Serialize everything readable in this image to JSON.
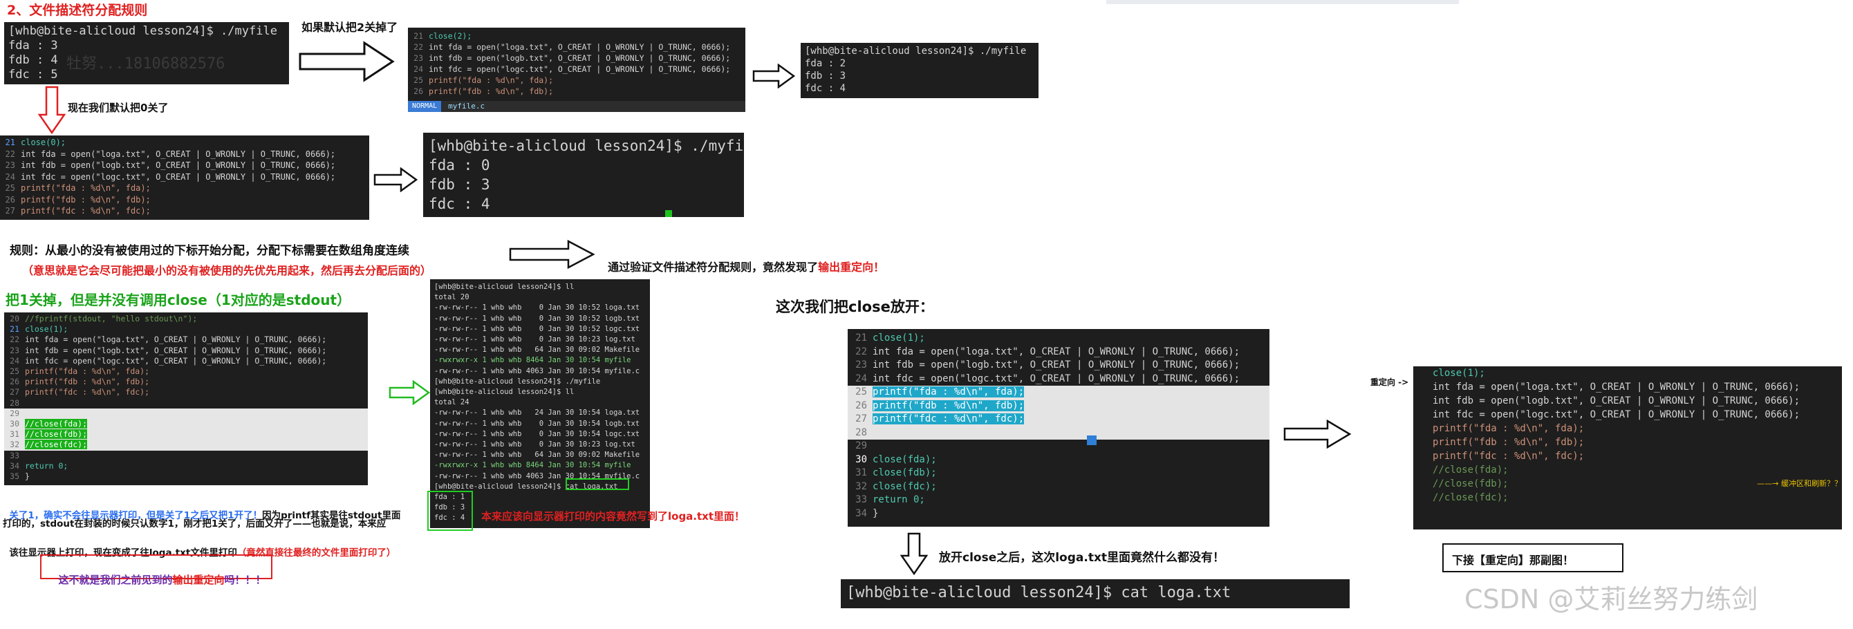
{
  "header": {
    "title": "2、文件描述符分配规则"
  },
  "panel1": {
    "prompt": "[whb@bite-alicloud lesson24]$ ./myfile",
    "lines": [
      "fda : 3",
      "fdb : 4",
      "fdc : 5"
    ],
    "watermark": "牡努...18106882576"
  },
  "note_default_close2": "如果默认把2关掉了",
  "note_close0": "现在我们默认把0关了",
  "panel2": {
    "line_numbers": [
      "21",
      "22",
      "23",
      "24",
      "25",
      "26"
    ],
    "lines": [
      "close(2);",
      "int fda = open(\"loga.txt\", O_CREAT | O_WRONLY | O_TRUNC, 0666);",
      "int fdb = open(\"logb.txt\", O_CREAT | O_WRONLY | O_TRUNC, 0666);",
      "int fdc = open(\"logc.txt\", O_CREAT | O_WRONLY | O_TRUNC, 0666);",
      "printf(\"fda : %d\\n\", fda);",
      "printf(\"fdb : %d\\n\", fdb);"
    ],
    "mode": "NORMAL",
    "file": "myfile.c"
  },
  "panel3": {
    "prompt": "[whb@bite-alicloud lesson24]$ ./myfile",
    "lines": [
      "fda : 2",
      "fdb : 3",
      "fdc : 4"
    ]
  },
  "panel4": {
    "line_numbers": [
      "21",
      "22",
      "23",
      "24",
      "25",
      "26",
      "27"
    ],
    "lines": [
      "close(0);",
      "int fda = open(\"loga.txt\", O_CREAT | O_WRONLY | O_TRUNC, 0666);",
      "int fdb = open(\"logb.txt\", O_CREAT | O_WRONLY | O_TRUNC, 0666);",
      "int fdc = open(\"logc.txt\", O_CREAT | O_WRONLY | O_TRUNC, 0666);",
      "printf(\"fda : %d\\n\", fda);",
      "printf(\"fdb : %d\\n\", fdb);",
      "printf(\"fdc : %d\\n\", fdc);"
    ]
  },
  "panel5": {
    "prompt": "[whb@bite-alicloud lesson24]$ ./myfile",
    "lines": [
      "fda : 0",
      "fdb : 3",
      "fdc : 4"
    ]
  },
  "rule_text": "规则：从最小的没有被使用过的下标开始分配，分配下标需要在数组角度连续",
  "rule_sub": "（意思就是它会尽可能把最小的没有被使用的先优先用起来，然后再去分配后面的）",
  "verify_text_prefix": "通过验证文件描述符分配规则，竟然发现了",
  "verify_text_red": "输出重定向！",
  "close1_title": "把1关掉，但是并没有调用close（1对应的是stdout）",
  "panel6": {
    "line_numbers": [
      "20",
      "21",
      "22",
      "23",
      "24",
      "25",
      "26",
      "27",
      "28",
      "29",
      "30",
      "31",
      "32",
      "33",
      "34",
      "35"
    ],
    "lines": [
      "//fprintf(stdout, \"hello stdout\\n\");",
      "close(1);",
      "int fda = open(\"loga.txt\", O_CREAT | O_WRONLY | O_TRUNC, 0666);",
      "int fdb = open(\"logb.txt\", O_CREAT | O_WRONLY | O_TRUNC, 0666);",
      "int fdc = open(\"logc.txt\", O_CREAT | O_WRONLY | O_TRUNC, 0666);",
      "printf(\"fda : %d\\n\", fda);",
      "printf(\"fdb : %d\\n\", fdb);",
      "printf(\"fdc : %d\\n\", fdc);",
      "",
      "",
      "//close(fda);",
      "//close(fdb);",
      "//close(fdc);",
      "",
      "return 0;",
      "}"
    ]
  },
  "panel7": {
    "lines": [
      "[whb@bite-alicloud lesson24]$ ll",
      "total 20",
      "-rw-rw-r-- 1 whb whb    0 Jan 30 10:52 loga.txt",
      "-rw-rw-r-- 1 whb whb    0 Jan 30 10:52 logb.txt",
      "-rw-rw-r-- 1 whb whb    0 Jan 30 10:52 logc.txt",
      "-rw-rw-r-- 1 whb whb    0 Jan 30 10:23 log.txt",
      "-rw-rw-r-- 1 whb whb   64 Jan 30 09:02 Makefile",
      "-rwxrwxr-x 1 whb whb 8464 Jan 30 10:54 myfile",
      "-rw-rw-r-- 1 whb whb 4063 Jan 30 10:54 myfile.c",
      "[whb@bite-alicloud lesson24]$ ./myfile",
      "[whb@bite-alicloud lesson24]$ ll",
      "total 24",
      "-rw-rw-r-- 1 whb whb   24 Jan 30 10:54 loga.txt",
      "-rw-rw-r-- 1 whb whb    0 Jan 30 10:54 logb.txt",
      "-rw-rw-r-- 1 whb whb    0 Jan 30 10:54 logc.txt",
      "-rw-rw-r-- 1 whb whb    0 Jan 30 10:23 log.txt",
      "-rw-rw-r-- 1 whb whb   64 Jan 30 09:02 Makefile",
      "-rwxrwxr-x 1 whb whb 8464 Jan 30 10:54 myfile",
      "-rw-rw-r-- 1 whb whb 4063 Jan 30 10:54 myfile.c",
      "[whb@bite-alicloud lesson24]$ cat loga.txt",
      "fda : 1",
      "fdb : 3",
      "fdc : 4"
    ]
  },
  "panel7_note": "本来应该向显示器打印的内容竟然写到了loga.txt里面！",
  "explain": {
    "l1_blue": "关了1，确实不会往显示器打印，但是关了1之后又把1开了！",
    "l1_black": "因为printf其实是往stdout里面",
    "l2": "打印的，stdout在封装的时候只认数字1，刚才把1关了，后面又开了——也就是说，本来应",
    "l3_black": "该往显示器上打印，现在变成了往loga.txt文件里打印",
    "l3_red": "（竟然直接往最终的文件里面打印了）"
  },
  "callout": {
    "prefix": "这不就是我们之前见到的",
    "red": "输出重定向",
    "suffix": "吗！！！"
  },
  "close_open_title": "这次我们把close放开：",
  "panel8": {
    "line_numbers": [
      "21",
      "22",
      "23",
      "24",
      "25",
      "26",
      "27",
      "28",
      "29",
      "30",
      "31",
      "32",
      "33",
      "34"
    ],
    "lines": [
      "close(1);",
      "int fda = open(\"loga.txt\", O_CREAT | O_WRONLY | O_TRUNC, 0666);",
      "int fdb = open(\"logb.txt\", O_CREAT | O_WRONLY | O_TRUNC, 0666);",
      "int fdc = open(\"logc.txt\", O_CREAT | O_WRONLY | O_TRUNC, 0666);",
      "printf(\"fda : %d\\n\", fda);",
      "printf(\"fdb : %d\\n\", fdb);",
      "printf(\"fdc : %d\\n\", fdc);",
      "",
      "",
      "close(fda);",
      "close(fdb);",
      "close(fdc);",
      "return 0;",
      "}"
    ]
  },
  "after_close_note": "放开close之后，这次loga.txt里面竟然什么都没有！",
  "panel9": {
    "prompt": "[whb@bite-alicloud lesson24]$ cat loga.txt"
  },
  "redirect_label": "重定向 ->",
  "panel10": {
    "lines": [
      "close(1);",
      "int fda = open(\"loga.txt\", O_CREAT | O_WRONLY | O_TRUNC, 0666);",
      "int fdb = open(\"logb.txt\", O_CREAT | O_WRONLY | O_TRUNC, 0666);",
      "int fdc = open(\"logc.txt\", O_CREAT | O_WRONLY | O_TRUNC, 0666);",
      "printf(\"fda : %d\\n\", fda);",
      "printf(\"fdb : %d\\n\", fdb);",
      "printf(\"fdc : %d\\n\", fdc);",
      "",
      "",
      "//close(fda);",
      "//close(fdb);",
      "//close(fdc);"
    ],
    "annotation": "缓冲区和刷新？？"
  },
  "next_box": "下接【重定向】那副图！",
  "watermark": "CSDN @艾莉丝努力练剑",
  "colors": {
    "accent_red": "#e02020",
    "accent_green": "#1aa31a",
    "accent_blue": "#2a6df0",
    "terminal_bg": "#1e1e1e"
  }
}
